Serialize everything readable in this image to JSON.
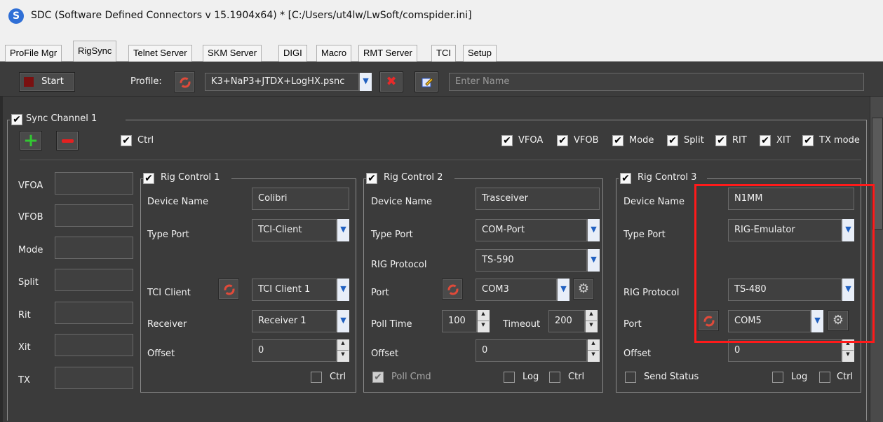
{
  "window": {
    "icon_letter": "S",
    "title": "SDC (Software Defined Connectors v 15.1904x64) * [C:/Users/ut4lw/LwSoft/comspider.ini]"
  },
  "tabs": [
    "ProFile Mgr",
    "RigSync",
    "Telnet Server",
    "SKM Server",
    "DIGI",
    "Macro",
    "RMT Server",
    "TCI",
    "Setup"
  ],
  "active_tab": "RigSync",
  "toolbar": {
    "start_label": "Start",
    "profile_label": "Profile:",
    "profile_value": "K3+NaP3+JTDX+LogHX.psnc",
    "name_placeholder": "Enter Name"
  },
  "sync_channel": {
    "title": "Sync Channel 1",
    "ctrl_label": "Ctrl",
    "flags": [
      "VFOA",
      "VFOB",
      "Mode",
      "Split",
      "RIT",
      "XIT",
      "TX mode"
    ]
  },
  "status_fields": [
    "VFOA",
    "VFOB",
    "Mode",
    "Split",
    "Rit",
    "Xit",
    "TX"
  ],
  "rig1": {
    "title": "Rig Control 1",
    "device_name_label": "Device Name",
    "device_name": "Colibri",
    "type_port_label": "Type Port",
    "type_port": "TCI-Client",
    "tci_client_label": "TCI Client",
    "tci_client": "TCI Client 1",
    "receiver_label": "Receiver",
    "receiver": "Receiver 1",
    "offset_label": "Offset",
    "offset": "0",
    "ctrl_label": "Ctrl"
  },
  "rig2": {
    "title": "Rig Control 2",
    "device_name_label": "Device Name",
    "device_name": "Trasceiver",
    "type_port_label": "Type Port",
    "type_port": "COM-Port",
    "rig_protocol_label": "RIG Protocol",
    "rig_protocol": "TS-590",
    "port_label": "Port",
    "port": "COM3",
    "poll_time_label": "Poll Time",
    "poll_time": "100",
    "timeout_label": "Timeout",
    "timeout": "200",
    "offset_label": "Offset",
    "offset": "0",
    "poll_cmd_label": "Poll Cmd",
    "log_label": "Log",
    "ctrl_label": "Ctrl"
  },
  "rig3": {
    "title": "Rig Control 3",
    "device_name_label": "Device Name",
    "device_name": "N1MM",
    "type_port_label": "Type Port",
    "type_port": "RIG-Emulator",
    "rig_protocol_label": "RIG Protocol",
    "rig_protocol": "TS-480",
    "port_label": "Port",
    "port": "COM5",
    "offset_label": "Offset",
    "offset": "0",
    "send_status_label": "Send Status",
    "log_label": "Log",
    "ctrl_label": "Ctrl"
  },
  "colors": {
    "highlight": "#ff1a1a",
    "panel_bg": "#3b3b3b",
    "accent": "#2f6fd6"
  }
}
